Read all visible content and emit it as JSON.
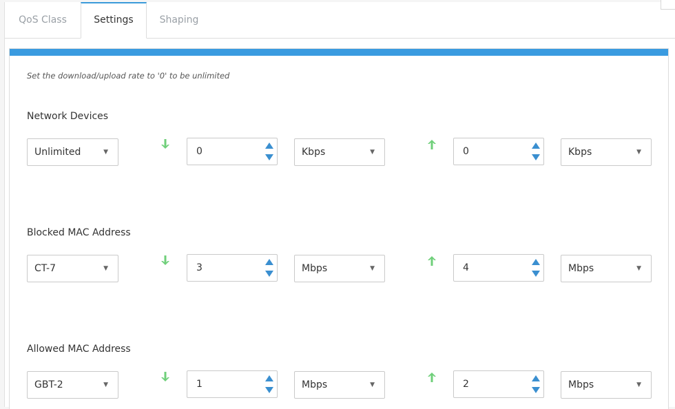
{
  "tabs": [
    {
      "label": "QoS Class",
      "active": false
    },
    {
      "label": "Settings",
      "active": true
    },
    {
      "label": "Shaping",
      "active": false
    }
  ],
  "hint": "Set the download/upload rate to '0' to be unlimited",
  "colors": {
    "accent": "#3a9be0",
    "download_arrow": "#6fcf7a",
    "upload_arrow": "#6fcf7a",
    "spinner": "#3a8fd0"
  },
  "icons": {
    "download": "arrow-down-icon",
    "upload": "arrow-up-icon",
    "caret": "chevron-down-icon"
  },
  "sections": [
    {
      "title": "Network Devices",
      "profile": "Unlimited",
      "download_value": "0",
      "download_unit": "Kbps",
      "upload_value": "0",
      "upload_unit": "Kbps"
    },
    {
      "title": "Blocked MAC Address",
      "profile": "CT-7",
      "download_value": "3",
      "download_unit": "Mbps",
      "upload_value": "4",
      "upload_unit": "Mbps"
    },
    {
      "title": "Allowed MAC Address",
      "profile": "GBT-2",
      "download_value": "1",
      "download_unit": "Mbps",
      "upload_value": "2",
      "upload_unit": "Mbps"
    }
  ]
}
